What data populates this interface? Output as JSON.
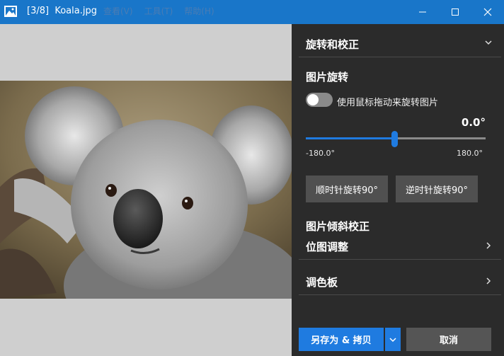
{
  "window": {
    "title": "[3/8]  Koala.jpg",
    "menu": [
      "查看(V)",
      "工具(T)",
      "帮助(H)"
    ]
  },
  "panel": {
    "rotate_section_title": "旋转和校正",
    "image_rotate_title": "图片旋转",
    "toggle_label": "使用鼠标拖动来旋转图片",
    "toggle_on": false,
    "angle_value": "0.0°",
    "slider_min": "-180.0°",
    "slider_max": "180.0°",
    "slider_position": 0.5,
    "rotate_cw_label": "顺时针旋转90°",
    "rotate_ccw_label": "逆时针旋转90°",
    "tilt_title": "图片倾斜校正",
    "bitmap_adjust_title": "位图调整",
    "palette_title": "调色板"
  },
  "footer": {
    "save_copy_label": "另存为 & 拷贝",
    "cancel_label": "取消"
  },
  "colors": {
    "titlebar": "#1976c9",
    "accent": "#1f7be0",
    "panel_bg": "#2b2b2b"
  }
}
